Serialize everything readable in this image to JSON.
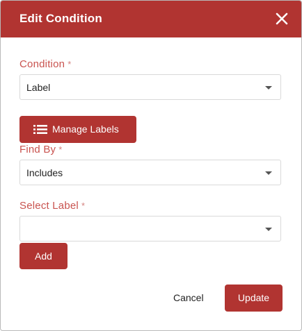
{
  "dialog": {
    "title": "Edit Condition",
    "close_icon": "close-icon"
  },
  "condition": {
    "label": "Condition",
    "required_mark": "*",
    "value": "Label"
  },
  "manage_labels": {
    "label": "Manage Labels",
    "icon": "list-icon"
  },
  "find_by": {
    "label": "Find By",
    "required_mark": "*",
    "value": "Includes"
  },
  "select_label": {
    "label": "Select Label",
    "required_mark": "*",
    "value": ""
  },
  "buttons": {
    "add": "Add",
    "cancel": "Cancel",
    "update": "Update"
  },
  "colors": {
    "accent": "#b13431",
    "label_text": "#c9534f"
  }
}
